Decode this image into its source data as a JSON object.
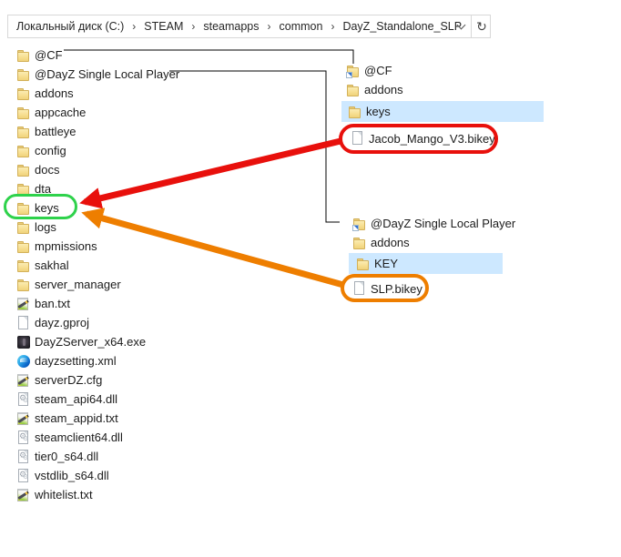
{
  "breadcrumb": {
    "separator": "›",
    "segments": [
      {
        "label": "Локальный диск (C:)"
      },
      {
        "label": "STEAM"
      },
      {
        "label": "steamapps"
      },
      {
        "label": "common"
      },
      {
        "label": "DayZ_Standalone_SLP"
      }
    ],
    "refresh_icon": "↻",
    "dropdown_icon": "chevron-down"
  },
  "root_list": {
    "items": [
      {
        "label": "@CF",
        "icon": "folder"
      },
      {
        "label": "@DayZ Single Local Player",
        "icon": "folder"
      },
      {
        "label": "addons",
        "icon": "folder"
      },
      {
        "label": "appcache",
        "icon": "folder"
      },
      {
        "label": "battleye",
        "icon": "folder"
      },
      {
        "label": "config",
        "icon": "folder"
      },
      {
        "label": "docs",
        "icon": "folder"
      },
      {
        "label": "dta",
        "icon": "folder"
      },
      {
        "label": "keys",
        "icon": "folder"
      },
      {
        "label": "logs",
        "icon": "folder"
      },
      {
        "label": "mpmissions",
        "icon": "folder"
      },
      {
        "label": "sakhal",
        "icon": "folder"
      },
      {
        "label": "server_manager",
        "icon": "folder"
      },
      {
        "label": "ban.txt",
        "icon": "notepad"
      },
      {
        "label": "dayz.gproj",
        "icon": "file"
      },
      {
        "label": "DayZServer_x64.exe",
        "icon": "app-dark"
      },
      {
        "label": "dayzsetting.xml",
        "icon": "edge"
      },
      {
        "label": "serverDZ.cfg",
        "icon": "notepad"
      },
      {
        "label": "steam_api64.dll",
        "icon": "dll"
      },
      {
        "label": "steam_appid.txt",
        "icon": "notepad"
      },
      {
        "label": "steamclient64.dll",
        "icon": "dll"
      },
      {
        "label": "tier0_s64.dll",
        "icon": "dll"
      },
      {
        "label": "vstdlib_s64.dll",
        "icon": "dll"
      },
      {
        "label": "whitelist.txt",
        "icon": "notepad"
      }
    ]
  },
  "cf_panel": {
    "items": [
      {
        "label": "@CF",
        "icon": "folder-shortcut"
      },
      {
        "label": "addons",
        "icon": "folder"
      },
      {
        "label": "keys",
        "icon": "folder",
        "selected": true
      },
      {
        "label": "Jacob_Mango_V3.bikey",
        "icon": "file"
      }
    ]
  },
  "slp_panel": {
    "items": [
      {
        "label": "@DayZ Single Local Player",
        "icon": "folder-shortcut"
      },
      {
        "label": "addons",
        "icon": "folder"
      },
      {
        "label": "KEY",
        "icon": "folder",
        "selected": true
      },
      {
        "label": "SLP.bikey",
        "icon": "file"
      }
    ]
  },
  "annotations": {
    "green_ellipse": {
      "target": "keys",
      "color": "#2ed24b"
    },
    "red_circle": {
      "target": "Jacob_Mango_V3.bikey",
      "color": "#e8100c"
    },
    "orange_circle": {
      "target": "SLP.bikey",
      "color": "#ee7e00"
    },
    "red_arrow": {
      "from": "Jacob_Mango_V3.bikey",
      "to": "keys",
      "color": "#e8100c"
    },
    "orange_arrow": {
      "from": "SLP.bikey",
      "to": "keys",
      "color": "#ee7e00"
    }
  },
  "colors": {
    "selection": "#cde8ff",
    "connector": "#000000",
    "folder": "#f6dd8e",
    "bar_border": "#d8d8d8"
  }
}
